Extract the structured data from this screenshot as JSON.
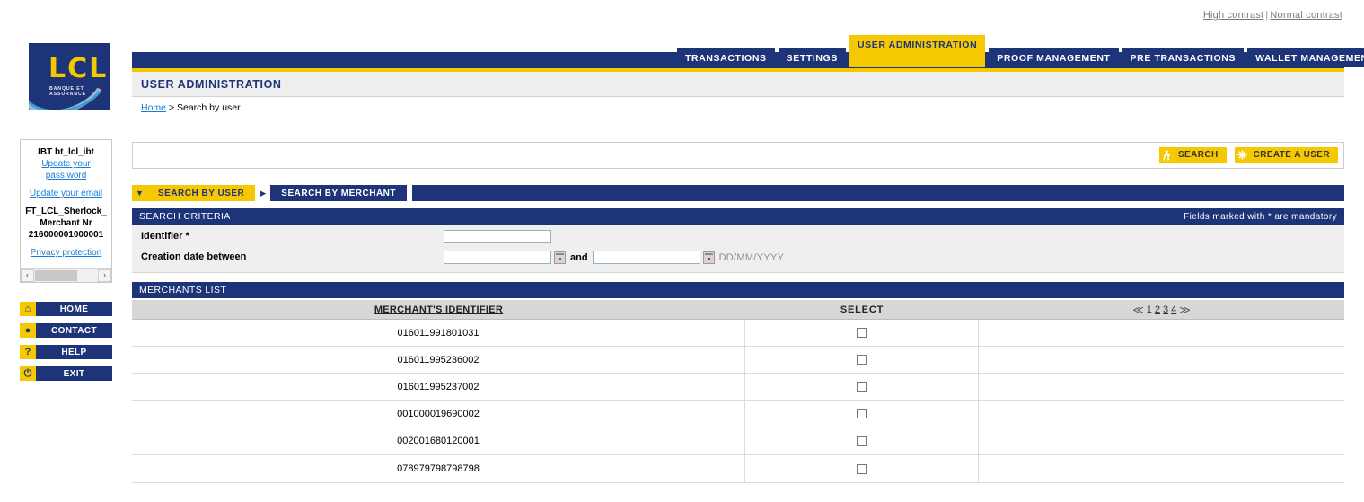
{
  "topbar": {
    "high_contrast": "High contrast",
    "separator": "|",
    "normal_contrast": "Normal contrast"
  },
  "logo": {
    "mark": "LCL",
    "tagline": "BANQUE ET ASSURANCE"
  },
  "sidebar": {
    "user_id": "IBT bt_lcl_ibt",
    "update_password_line1": "Update your",
    "update_password_line2": "pass word",
    "update_email": "Update your email",
    "merchant_name": "FT_LCL_Sherlock_",
    "merchant_nr_label": "Merchant Nr",
    "merchant_nr_value": "216000001000001",
    "privacy": "Privacy protection",
    "scroll_left": "‹",
    "scroll_right": "›",
    "nav": [
      {
        "label": "HOME",
        "icon": "home-icon",
        "glyph": "⌂"
      },
      {
        "label": "CONTACT",
        "icon": "speech-bubble-icon",
        "glyph": "●"
      },
      {
        "label": "HELP",
        "icon": "question-mark-icon",
        "glyph": "?"
      },
      {
        "label": "EXIT",
        "icon": "power-icon",
        "glyph": "⏻"
      }
    ]
  },
  "tabs": [
    {
      "label": "TRANSACTIONS",
      "active": false
    },
    {
      "label": "SETTINGS",
      "active": false
    },
    {
      "label": "USER ADMINISTRATION",
      "active": true
    },
    {
      "label": "PROOF MANAGEMENT",
      "active": false
    },
    {
      "label": "PRE TRANSACTIONS",
      "active": false
    },
    {
      "label": "WALLET MANAGEMENT",
      "active": false
    }
  ],
  "page": {
    "title": "USER ADMINISTRATION",
    "breadcrumb_home": "Home",
    "breadcrumb_sep": "> ",
    "breadcrumb_current": "Search by user"
  },
  "actions": {
    "search": {
      "label": "SEARCH",
      "icon": "person-walking-icon",
      "glyph": "Ὣ6"
    },
    "create_user": {
      "label": "CREATE A USER",
      "icon": "starburst-icon",
      "glyph": "✸"
    }
  },
  "subtabs": [
    {
      "label": "SEARCH BY USER",
      "active": true,
      "arrow": "▼"
    },
    {
      "label": "SEARCH BY MERCHANT",
      "active": false,
      "arrow": "▶"
    }
  ],
  "criteria": {
    "section_title": "SEARCH CRITERIA",
    "mandatory_note": "Fields marked with * are mandatory",
    "identifier_label": "Identifier *",
    "identifier_value": "",
    "identifier_placeholder": "",
    "creation_date_label": "Creation date between",
    "date_from_value": "",
    "date_to_value": "",
    "and_text": "and",
    "date_format": "DD/MM/YYYY",
    "calendar_icon": "calendar-icon"
  },
  "merchants": {
    "section_title": "MERCHANTS LIST",
    "col_identifier": "MERCHANT'S IDENTIFIER",
    "col_select": "SELECT",
    "pager": {
      "first": "≪",
      "last": "≫",
      "pages": [
        "1",
        "2",
        "3",
        "4"
      ],
      "current": "1"
    },
    "rows": [
      {
        "identifier": "016011991801031",
        "checked": false
      },
      {
        "identifier": "016011995236002",
        "checked": false
      },
      {
        "identifier": "016011995237002",
        "checked": false
      },
      {
        "identifier": "001000019690002",
        "checked": false
      },
      {
        "identifier": "002001680120001",
        "checked": false
      },
      {
        "identifier": "078979798798798",
        "checked": false
      }
    ]
  },
  "colors": {
    "navy": "#1e3478",
    "yellow": "#f5c800",
    "link_blue": "#1a7fd4",
    "header_gray": "#efefef",
    "table_header_gray": "#d7d7d7"
  }
}
